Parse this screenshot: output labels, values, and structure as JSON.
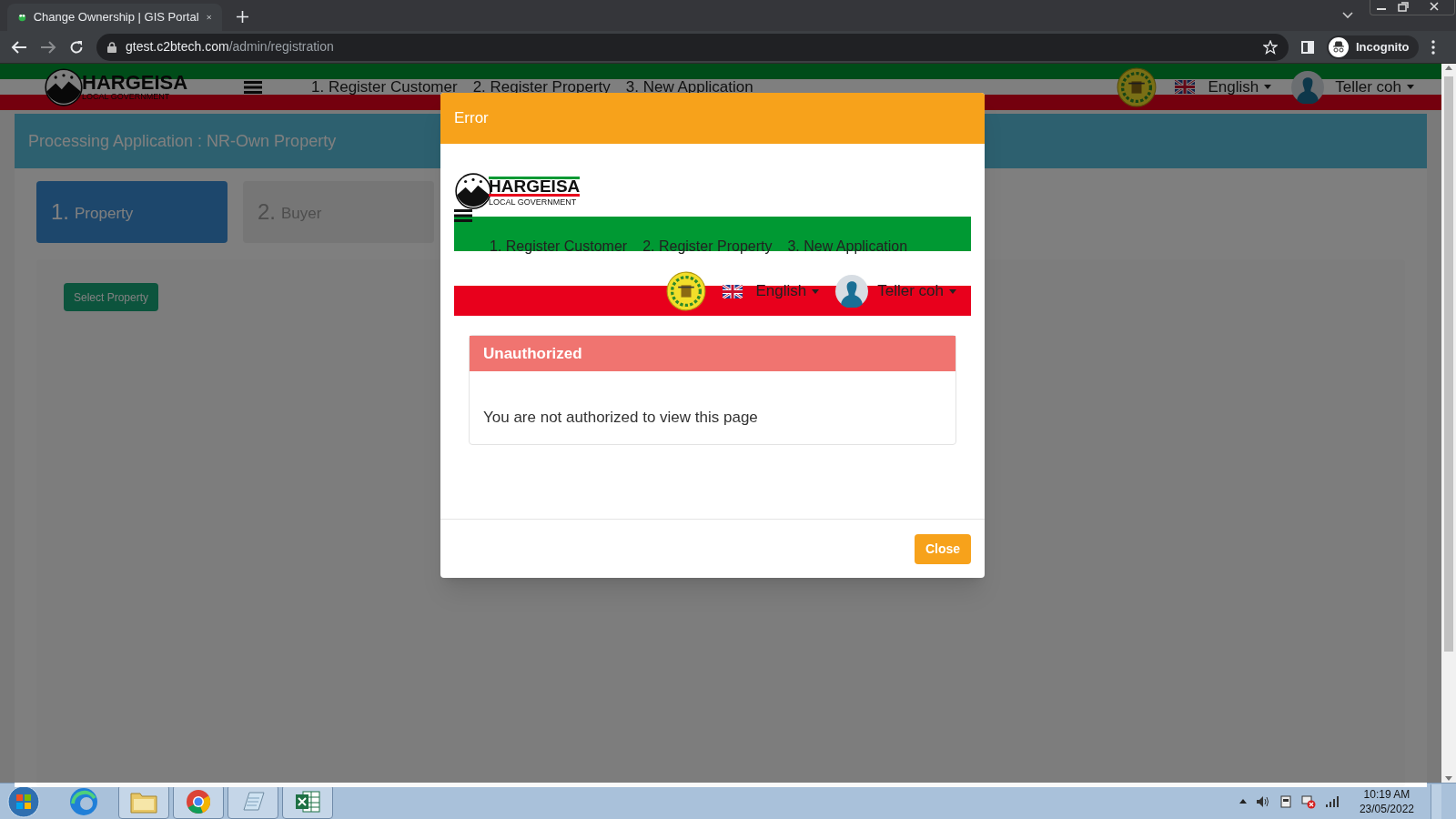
{
  "browser": {
    "tab_title": "Change Ownership | GIS Portal",
    "url_host": "gtest.c2btech.com",
    "url_path": "/admin/registration",
    "profile": "Incognito"
  },
  "header": {
    "logo_title": "HARGEISA",
    "logo_subtitle": "LOCAL GOVERNMENT",
    "nav": [
      "1. Register Customer",
      "2. Register Property",
      "3. New Application"
    ],
    "language": "English",
    "user": "Teller coh"
  },
  "panel": {
    "title": "Processing Application : NR-Own Property",
    "steps": [
      {
        "number": "1.",
        "label": "Property",
        "selected": true
      },
      {
        "number": "2.",
        "label": "Buyer",
        "selected": false
      }
    ],
    "select_button": "Select Property"
  },
  "modal": {
    "title": "Error",
    "header": {
      "logo_title": "HARGEISA",
      "logo_subtitle": "LOCAL GOVERNMENT",
      "nav": [
        "1. Register Customer",
        "2. Register Property",
        "3. New Application"
      ],
      "language": "English",
      "user": "Teller coh"
    },
    "alert_title": "Unauthorized",
    "message": "You are not authorized to view this page",
    "close": "Close"
  },
  "taskbar": {
    "time": "10:19 AM",
    "date": "23/05/2022"
  }
}
